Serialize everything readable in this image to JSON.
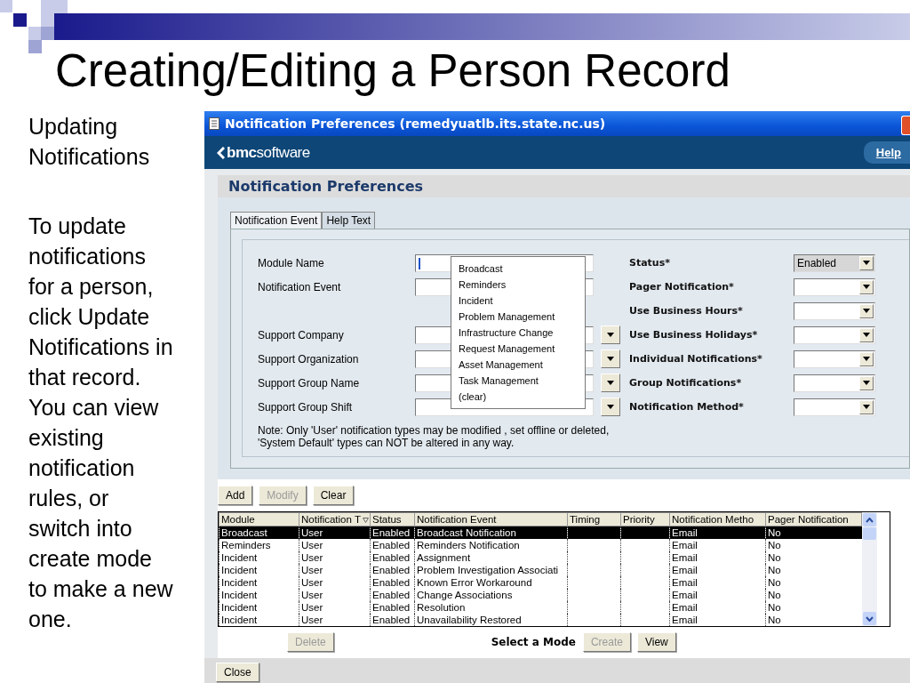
{
  "slide": {
    "title": "Creating/Editing a Person Record",
    "heading": "Updating Notifications",
    "body": "To update notifications for a person, click Update Notifications in that record. You can view existing notification rules, or switch into create mode to make a new one."
  },
  "window": {
    "title": "Notification Preferences (remedyuatlb.its.state.nc.us)",
    "logo": "**bmc**software",
    "help_link": "Help",
    "panel_title": "Notification Preferences",
    "tabs": [
      {
        "label": "Notification Event",
        "selected": true
      },
      {
        "label": "Help Text",
        "selected": false
      }
    ],
    "left_fields": [
      {
        "label": "Module Name",
        "has_cursor": true,
        "dropdown": false
      },
      {
        "label": "Notification Event",
        "has_cursor": false,
        "dropdown": false
      },
      {
        "label": "Support Company",
        "has_cursor": false,
        "dropdown": true
      },
      {
        "label": "Support Organization",
        "has_cursor": false,
        "dropdown": true
      },
      {
        "label": "Support Group Name",
        "has_cursor": false,
        "dropdown": true
      },
      {
        "label": "Support Group Shift",
        "has_cursor": false,
        "dropdown": true
      }
    ],
    "right_fields": [
      {
        "label": "Status*",
        "value": "Enabled",
        "read_only": true
      },
      {
        "label": "Pager Notification*",
        "read_only": false
      },
      {
        "label": "Use Business Hours*",
        "read_only": false
      },
      {
        "label": "Use Business Holidays*",
        "read_only": false
      },
      {
        "label": "Individual Notifications*",
        "read_only": false
      },
      {
        "label": "Group Notifications*",
        "read_only": false
      },
      {
        "label": "Notification Method*",
        "read_only": false
      }
    ],
    "dropdown_menu": {
      "items": [
        "Broadcast",
        "Reminders",
        "Incident",
        "Problem Management",
        "Infrastructure Change",
        "Request Management",
        "Asset Management",
        "Task Management",
        "(clear)"
      ]
    },
    "note": "Note: Only 'User' notification types may be modified , set offline or deleted,\n'System Default' types can NOT be altered in any way.",
    "list_buttons": [
      {
        "label": "Add",
        "disabled": false
      },
      {
        "label": "Modify",
        "disabled": true
      },
      {
        "label": "Clear",
        "disabled": false
      }
    ],
    "table": {
      "columns": [
        {
          "label": "Module",
          "sorted": false
        },
        {
          "label": "Notification T",
          "sorted": true
        },
        {
          "label": "Status",
          "sorted": false
        },
        {
          "label": "Notification Event",
          "sorted": false
        },
        {
          "label": "Timing",
          "sorted": false
        },
        {
          "label": "Priority",
          "sorted": false
        },
        {
          "label": "Notification Metho",
          "sorted": false
        },
        {
          "label": "Pager Notification",
          "sorted": false
        }
      ],
      "rows": [
        {
          "cells": [
            "Broadcast",
            "User",
            "Enabled",
            "Broadcast Notification",
            "",
            "",
            "Email",
            "No"
          ],
          "selected": true
        },
        {
          "cells": [
            "Reminders",
            "User",
            "Enabled",
            "Reminders Notification",
            "",
            "",
            "Email",
            "No"
          ],
          "selected": false
        },
        {
          "cells": [
            "Incident",
            "User",
            "Enabled",
            "Assignment",
            "",
            "",
            "Email",
            "No"
          ],
          "selected": false
        },
        {
          "cells": [
            "Incident",
            "User",
            "Enabled",
            "Problem Investigation Associati",
            "",
            "",
            "Email",
            "No"
          ],
          "selected": false
        },
        {
          "cells": [
            "Incident",
            "User",
            "Enabled",
            "Known Error Workaround",
            "",
            "",
            "Email",
            "No"
          ],
          "selected": false
        },
        {
          "cells": [
            "Incident",
            "User",
            "Enabled",
            "Change Associations",
            "",
            "",
            "Email",
            "No"
          ],
          "selected": false
        },
        {
          "cells": [
            "Incident",
            "User",
            "Enabled",
            "Resolution",
            "",
            "",
            "Email",
            "No"
          ],
          "selected": false
        },
        {
          "cells": [
            "Incident",
            "User",
            "Enabled",
            "Unavailability Restored",
            "",
            "",
            "Email",
            "No"
          ],
          "selected": false
        }
      ]
    },
    "delete_button": {
      "label": "Delete",
      "disabled": true
    },
    "mode_label": "Select a Mode",
    "mode_buttons": [
      {
        "label": "Create",
        "disabled": true
      },
      {
        "label": "View",
        "disabled": false
      }
    ],
    "close_button": {
      "label": "Close",
      "disabled": false
    }
  }
}
